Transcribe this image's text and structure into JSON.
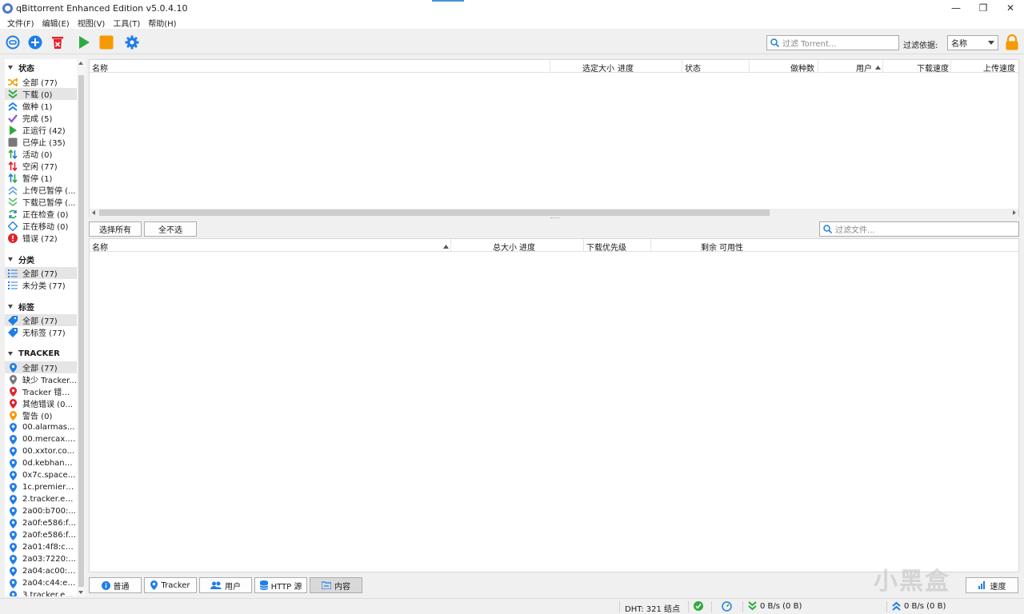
{
  "window": {
    "title": "qBittorrent Enhanced Edition v5.0.4.10",
    "minimize": "—",
    "restore": "❐",
    "close": "✕"
  },
  "menu": [
    "文件(F)",
    "编辑(E)",
    "视图(V)",
    "工具(T)",
    "帮助(H)"
  ],
  "toolbar": {
    "icons": [
      "link-add-icon",
      "add-icon",
      "delete-icon",
      "start-icon",
      "stop-icon",
      "settings-icon"
    ],
    "search_placeholder": "过滤 Torrent...",
    "filter_label": "过滤依据:",
    "filter_value": "名称"
  },
  "colors": {
    "accent_blue": "#1f7ee6",
    "green": "#2eaa3f",
    "orange": "#f59a00",
    "red": "#e0242b",
    "purple": "#8a55d6",
    "gray": "#777777"
  },
  "sidebar": {
    "status_header": "状态",
    "status_items": [
      {
        "label": "全部 (77)",
        "icon": "shuffle-icon"
      },
      {
        "label": "下载 (0)",
        "icon": "download-chevrons-icon"
      },
      {
        "label": "做种 (1)",
        "icon": "upload-chevrons-icon"
      },
      {
        "label": "完成 (5)",
        "icon": "checkmark-icon"
      },
      {
        "label": "正运行 (42)",
        "icon": "play-icon"
      },
      {
        "label": "已停止 (35)",
        "icon": "stop-square-icon"
      },
      {
        "label": "活动 (0)",
        "icon": "active-arrows-icon"
      },
      {
        "label": "空闲 (77)",
        "icon": "inactive-arrows-icon"
      },
      {
        "label": "暂停 (1)",
        "icon": "stalled-arrows-icon"
      },
      {
        "label": "上传已暂停 (...",
        "icon": "upload-stalled-icon"
      },
      {
        "label": "下载已暂停 (...",
        "icon": "download-stalled-icon"
      },
      {
        "label": "正在检查 (0)",
        "icon": "checking-icon"
      },
      {
        "label": "正在移动 (0)",
        "icon": "moving-icon"
      },
      {
        "label": "错误 (72)",
        "icon": "error-icon"
      }
    ],
    "category_header": "分类",
    "category_items": [
      {
        "label": "全部 (77)",
        "icon": "list-icon"
      },
      {
        "label": "未分类 (77)",
        "icon": "list-icon"
      }
    ],
    "tag_header": "标签",
    "tag_items": [
      {
        "label": "全部 (77)",
        "icon": "tag-icon"
      },
      {
        "label": "无标签 (77)",
        "icon": "tag-icon"
      }
    ],
    "tracker_header": "TRACKER",
    "tracker_items": [
      {
        "label": "全部 (77)",
        "icon": "pin-blue-icon"
      },
      {
        "label": "缺少 Tracker...",
        "icon": "pin-gray-icon"
      },
      {
        "label": "Tracker 错误...",
        "icon": "pin-red-icon"
      },
      {
        "label": "其他错误 (0...",
        "icon": "pin-red-icon"
      },
      {
        "label": "警告 (0)",
        "icon": "pin-orange-icon"
      },
      {
        "label": "00.alarmas...",
        "icon": "pin-blue-icon"
      },
      {
        "label": "00.mercax.c...",
        "icon": "pin-blue-icon"
      },
      {
        "label": "00.xxtor.co...",
        "icon": "pin-blue-icon"
      },
      {
        "label": "0d.kebhana...",
        "icon": "pin-blue-icon"
      },
      {
        "label": "0x7c.space ...",
        "icon": "pin-blue-icon"
      },
      {
        "label": "1c.premierz...",
        "icon": "pin-blue-icon"
      },
      {
        "label": "2.tracker.eu....",
        "icon": "pin-blue-icon"
      },
      {
        "label": "2a00:b700:...",
        "icon": "pin-blue-icon"
      },
      {
        "label": "2a0f:e586:f:...",
        "icon": "pin-blue-icon"
      },
      {
        "label": "2a0f:e586:f:...",
        "icon": "pin-blue-icon"
      },
      {
        "label": "2a01:4f8:c0...",
        "icon": "pin-blue-icon"
      },
      {
        "label": "2a03:7220:...",
        "icon": "pin-blue-icon"
      },
      {
        "label": "2a04:ac00:1...",
        "icon": "pin-blue-icon"
      },
      {
        "label": "2a04:c44:e0...",
        "icon": "pin-blue-icon"
      },
      {
        "label": "3.tracker.eu...",
        "icon": "pin-blue-icon"
      }
    ]
  },
  "torrent_table": {
    "columns": [
      "名称",
      "选定大小",
      "进度",
      "状态",
      "做种数",
      "用户",
      "下载速度",
      "上传速度"
    ]
  },
  "content": {
    "select_all": "选择所有",
    "select_none": "全不选",
    "filter_placeholder": "过滤文件...",
    "columns": [
      "名称",
      "总大小",
      "进度",
      "下载优先级",
      "剩余",
      "可用性"
    ]
  },
  "tabs": [
    {
      "label": "普通",
      "icon": "info-icon"
    },
    {
      "label": "Tracker",
      "icon": "pin-icon"
    },
    {
      "label": "用户",
      "icon": "users-icon"
    },
    {
      "label": "HTTP 源",
      "icon": "database-icon"
    },
    {
      "label": "内容",
      "icon": "folder-icon"
    }
  ],
  "speed_button": "速度",
  "status": {
    "dht": "DHT: 321 结点",
    "download": "0 B/s (0 B)",
    "upload": "0 B/s (0 B)"
  },
  "watermark": "小黑盒"
}
